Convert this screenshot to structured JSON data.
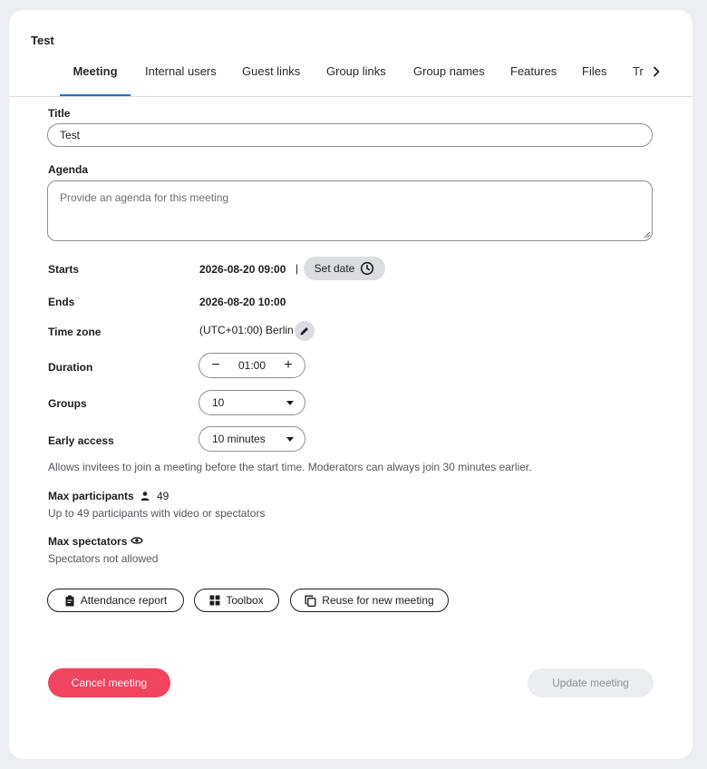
{
  "dialog": {
    "title": "Test"
  },
  "tabs": {
    "items": [
      "Meeting",
      "Internal users",
      "Guest links",
      "Group links",
      "Group names",
      "Features",
      "Files"
    ],
    "overflow_label": "Tr",
    "active": "Meeting"
  },
  "form": {
    "title_label": "Title",
    "title_value": "Test",
    "agenda_label": "Agenda",
    "agenda_placeholder": "Provide an agenda for this meeting",
    "starts_label": "Starts",
    "starts_value": "2026-08-20 09:00",
    "starts_separator": "|",
    "set_date_label": "Set date",
    "ends_label": "Ends",
    "ends_value": "2026-08-20 10:00",
    "timezone_label": "Time zone",
    "timezone_value": "(UTC+01:00) Berlin",
    "duration_label": "Duration",
    "duration_value": "01:00",
    "duration_minus": "−",
    "duration_plus": "+",
    "groups_label": "Groups",
    "groups_value": "10",
    "early_access_label": "Early access",
    "early_access_value": "10 minutes",
    "early_access_hint": "Allows invitees to join a meeting before the start time. Moderators can always join 30 minutes earlier.",
    "max_participants_label": "Max participants",
    "max_participants_value": "49",
    "max_participants_hint": "Up to 49 participants with video or spectators",
    "max_spectators_label": "Max spectators",
    "max_spectators_hint": "Spectators not allowed"
  },
  "actions": {
    "attendance_report": "Attendance report",
    "toolbox": "Toolbox",
    "reuse": "Reuse for new meeting",
    "cancel": "Cancel meeting",
    "update": "Update meeting"
  },
  "colors": {
    "accent": "#2c6cb9",
    "danger": "#f0445f",
    "disabled_bg": "#ecedf0",
    "page_bg": "#edeef1"
  },
  "icons": [
    "chevron-right-icon",
    "clock-icon",
    "pencil-icon",
    "person-icon",
    "eye-icon",
    "clipboard-icon",
    "grid-icon",
    "copy-icon",
    "chevron-down-icon"
  ]
}
